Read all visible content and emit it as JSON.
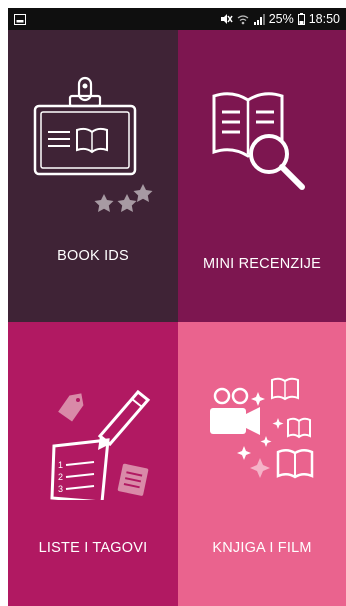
{
  "status_bar": {
    "battery_percent": "25%",
    "time": "18:50",
    "left_icon": "gallery-icon",
    "right_icons": [
      "mute-icon",
      "wifi-icon",
      "signal-icon",
      "battery-icon"
    ]
  },
  "tiles": [
    {
      "label": "BOOK IDS",
      "bg": "#3f2336",
      "icon": "id-card-icon"
    },
    {
      "label": "MINI RECENZIJE",
      "bg": "#7d1650",
      "icon": "book-magnifier-icon"
    },
    {
      "label": "LISTE I TAGOVI",
      "bg": "#b11962",
      "icon": "list-pencil-icon"
    },
    {
      "label": "KNJIGA I FILM",
      "bg": "#ea638e",
      "icon": "book-film-icon"
    }
  ]
}
